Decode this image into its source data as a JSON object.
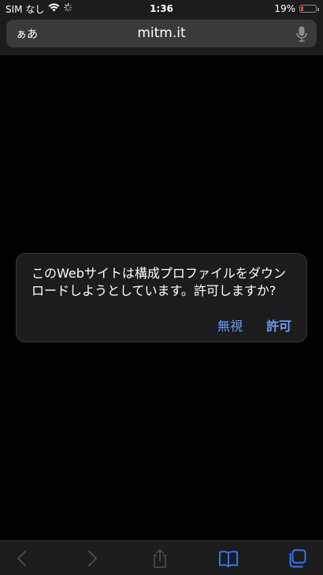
{
  "status_bar": {
    "carrier": "SIM なし",
    "time": "1:36",
    "battery_percent": "19%",
    "battery_level": 0.19,
    "battery_color": "#ff3b30",
    "wifi_icon": "wifi-icon",
    "activity_icon": "activity-spinner-icon"
  },
  "address_bar": {
    "aa_label": "ぁあ",
    "url": "mitm.it",
    "mic_icon": "microphone-icon"
  },
  "alert": {
    "message": "このWebサイトは構成プロファイルをダウンロードしようとしています。許可しますか?",
    "ignore_label": "無視",
    "allow_label": "許可",
    "button_color": "#6b9cf5"
  },
  "toolbar": {
    "back_icon": "back-chevron-icon",
    "back_enabled": false,
    "forward_icon": "forward-chevron-icon",
    "forward_enabled": false,
    "share_icon": "share-icon",
    "share_enabled": false,
    "bookmarks_icon": "bookmarks-book-icon",
    "tabs_icon": "tabs-icon",
    "accent_color": "#3478f6"
  }
}
